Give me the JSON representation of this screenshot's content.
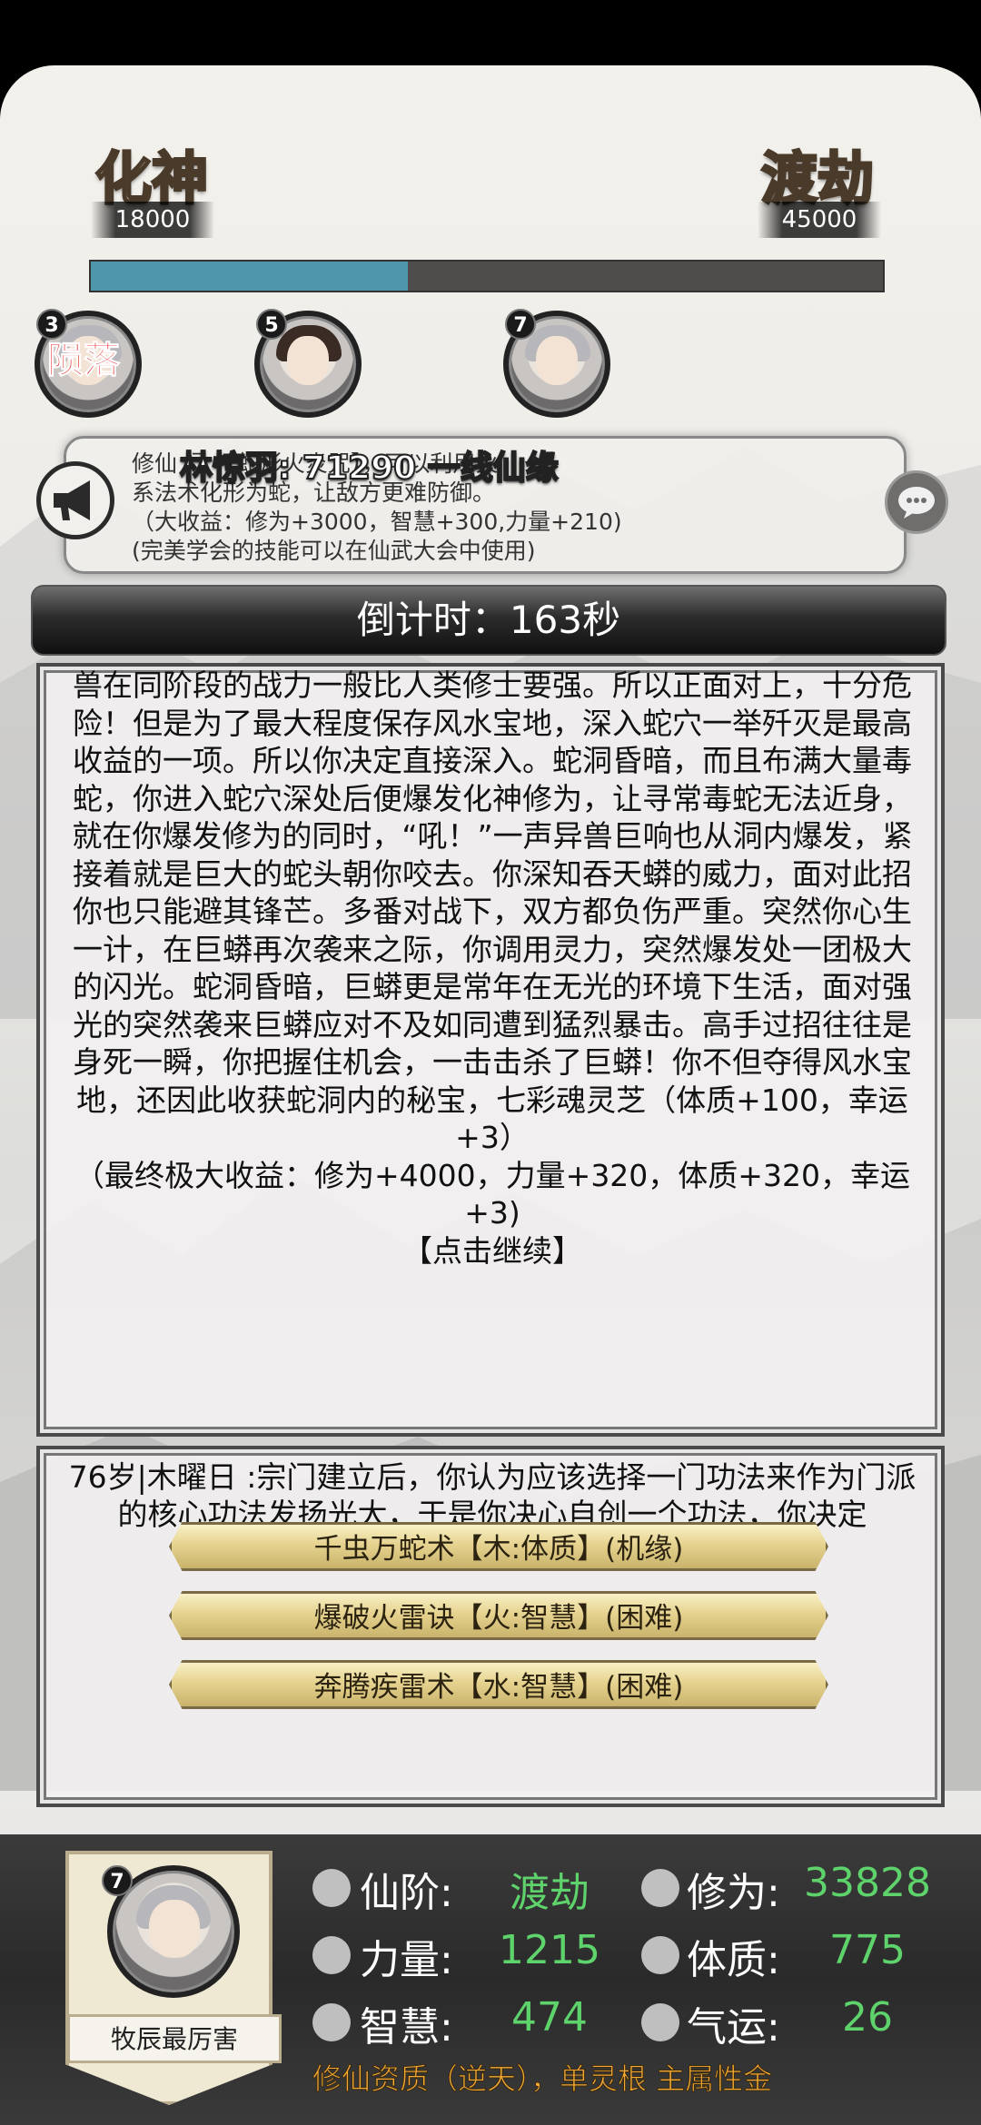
{
  "realm": {
    "current_name": "化神",
    "current_value": "18000",
    "next_name": "渡劫",
    "next_value": "45000",
    "progress_fraction": 0.4
  },
  "party": [
    {
      "level": "3",
      "status": "陨落"
    },
    {
      "level": "5",
      "status": ""
    },
    {
      "level": "7",
      "status": ""
    }
  ],
  "notice": {
    "broadcast": "林惊羽: 71290 一线仙缘",
    "line1": "修仙              门               【蛇形火炎咒】，可以利用火",
    "line2": "系法术化形为蛇，让敌方更难防御。",
    "line3": "（大收益：修为+3000，智慧+300,力量+210)",
    "line4": "(完美学会的技能可以在仙武大会中使用)"
  },
  "timer": {
    "label": "倒计时：163秒"
  },
  "story": {
    "paragraph": "兽在同阶段的战力一般比人类修士要强。所以正面对上，十分危险！但是为了最大程度保存风水宝地，深入蛇穴一举歼灭是最高收益的一项。所以你决定直接深入。蛇洞昏暗，而且布满大量毒蛇，你进入蛇穴深处后便爆发化神修为，让寻常毒蛇无法近身，就在你爆发修为的同时，“吼！”一声异兽巨响也从洞内爆发，紧接着就是巨大的蛇头朝你咬去。你深知吞天蟒的威力，面对此招你也只能避其锋芒。多番对战下，双方都负伤严重。突然你心生一计，在巨蟒再次袭来之际，你调用灵力，突然爆发处一团极大的闪光。蛇洞昏暗，巨蟒更是常年在无光的环境下生活，面对强光的突然袭来巨蟒应对不及如同遭到猛烈暴击。高手过招往往是身死一瞬，你把握住机会，一击击杀了巨蟒！你不但夺得风水宝地，还因此收获蛇洞内的秘宝，七彩魂灵芝（体质+100，幸运+3）",
    "reward": "（最终极大收益：修为+4000，力量+320，体质+320，幸运+3)",
    "continue": "【点击继续】"
  },
  "event": {
    "text": "76岁|木曜日 :宗门建立后，你认为应该选择一门功法来作为门派的核心功法发扬光大，于是你决心自创一个功法，你决定",
    "choices": [
      "千虫万蛇术【木:体质】(机缘)",
      "爆破火雷诀【火:智慧】(困难)",
      "奔腾疾雷术【水:智慧】(困难)"
    ]
  },
  "player": {
    "level": "7",
    "name": "牧辰最厉害",
    "stats": {
      "realm_label": "仙阶:",
      "realm_value": "渡劫",
      "cultivation_label": "修为:",
      "cultivation_value": "33828",
      "strength_label": "力量:",
      "strength_value": "1215",
      "constitution_label": "体质:",
      "constitution_value": "775",
      "wisdom_label": "智慧:",
      "wisdom_value": "474",
      "luck_label": "气运:",
      "luck_value": "26"
    },
    "qualification": "修仙资质（逆天），单灵根 主属性金"
  },
  "colors": {
    "accent_green": "#5fd36b",
    "progress": "#4e97ab",
    "fallen_red": "#e21b1b",
    "qualification_orange": "#f3a933"
  }
}
